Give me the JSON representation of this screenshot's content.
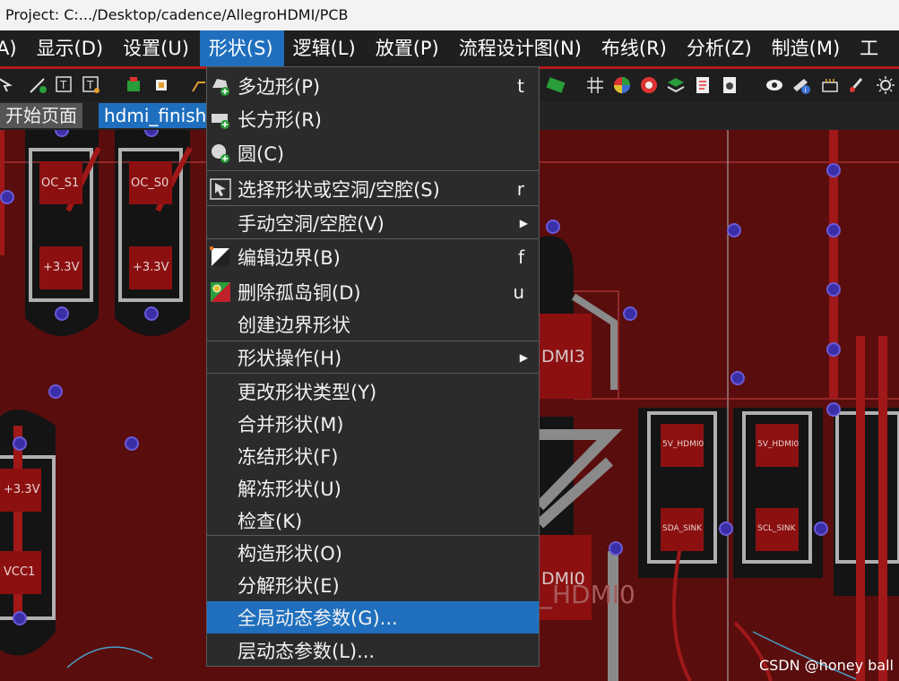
{
  "window": {
    "title": "Project: C:.../Desktop/cadence/AllegroHDMI/PCB"
  },
  "menubar": {
    "items": [
      "A)",
      "显示(D)",
      "设置(U)",
      "形状(S)",
      "逻辑(L)",
      "放置(P)",
      "流程设计图(N)",
      "布线(R)",
      "分析(Z)",
      "制造(M)",
      "工"
    ],
    "active_index": 3
  },
  "tabs": [
    {
      "label": "开始页面"
    },
    {
      "label": "hdmi_finish"
    }
  ],
  "shape_menu": {
    "items": [
      {
        "label": "多边形(P)",
        "shortcut": "t",
        "icon": "polygon-icon"
      },
      {
        "label": "长方形(R)",
        "shortcut": "",
        "icon": "rectangle-icon"
      },
      {
        "label": "圆(C)",
        "shortcut": "",
        "icon": "circle-icon"
      },
      {
        "label": "选择形状或空洞/空腔(S)",
        "shortcut": "r",
        "icon": "select-cursor-icon"
      },
      {
        "label": "手动空洞/空腔(V)",
        "shortcut": "",
        "icon": ""
      },
      {
        "label": "编辑边界(B)",
        "shortcut": "f",
        "icon": "edit-boundary-icon"
      },
      {
        "label": "删除孤岛铜(D)",
        "shortcut": "u",
        "icon": "delete-island-icon"
      },
      {
        "label": "创建边界形状",
        "shortcut": "",
        "icon": ""
      },
      {
        "label": "形状操作(H)",
        "shortcut": "",
        "icon": ""
      },
      {
        "label": "更改形状类型(Y)",
        "shortcut": "",
        "icon": ""
      },
      {
        "label": "合并形状(M)",
        "shortcut": "",
        "icon": ""
      },
      {
        "label": "冻结形状(F)",
        "shortcut": "",
        "icon": ""
      },
      {
        "label": "解冻形状(U)",
        "shortcut": "",
        "icon": ""
      },
      {
        "label": "检查(K)",
        "shortcut": "",
        "icon": ""
      },
      {
        "label": "构造形状(O)",
        "shortcut": "",
        "icon": ""
      },
      {
        "label": "分解形状(E)",
        "shortcut": "",
        "icon": ""
      },
      {
        "label": "全局动态参数(G)...",
        "shortcut": "",
        "icon": ""
      },
      {
        "label": "层动态参数(L)...",
        "shortcut": "",
        "icon": ""
      }
    ],
    "submenu_indices": [
      4,
      8
    ],
    "highlighted_index": 16
  },
  "pcb_labels": {
    "oc_s1": "OC_S1",
    "oc_s0": "OC_S0",
    "p33_a": "+3.3V",
    "p33_b": "+3.3V",
    "p33_c": "+3.3V",
    "vcc1": "VCC1",
    "dmi3": "DMI3",
    "dmi0": "DMI0",
    "hdmi0": "_HDMI0",
    "v5_hdmi0_a": "5V_HDMI0",
    "v5_hdmi0_b": "5V_HDMI0",
    "sda_sink": "SDA_SINK",
    "scl_sink": "SCL_SINK"
  },
  "watermark": "CSDN @honey ball",
  "colors": {
    "menu_highlight": "#1f6fbe",
    "pcb_copper": "#5a0d0d",
    "pcb_pad": "#8c1010",
    "via": "#3b2fa8"
  }
}
